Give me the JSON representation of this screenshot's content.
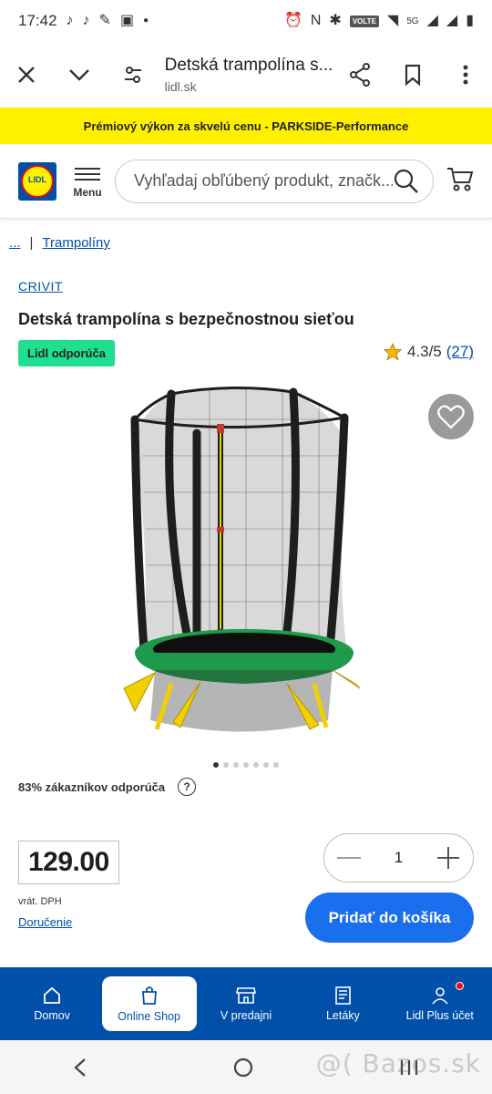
{
  "status_bar": {
    "time": "17:42",
    "network": "5G",
    "volte": "VOLTE"
  },
  "browser": {
    "title": "Detská trampolína s...",
    "url": "lidl.sk"
  },
  "promo_banner": {
    "text": "Prémiový výkon za skvelú cenu - PARKSIDE-Performance"
  },
  "header": {
    "logo_text": "LIDL",
    "menu_label": "Menu",
    "search_placeholder": "Vyhľadaj obľúbený produkt, značk..."
  },
  "breadcrumb": {
    "ellipsis": "...",
    "separator": "|",
    "category": "Trampolíny"
  },
  "product": {
    "brand": "CRIVIT",
    "title": "Detská trampolína s bezpečnostnou sieťou",
    "badge": "Lidl odporúča",
    "rating": "4.3/5",
    "rating_count": "(27)",
    "recommend": "83% zákazníkov odporúča",
    "recommend_help": "?",
    "price": "129.00",
    "vat_note": "vrát. DPH",
    "delivery_link": "Doručenie",
    "quantity": "1",
    "add_to_cart": "Pridať do košíka",
    "gallery_total": 7,
    "gallery_active": 0
  },
  "bottom_nav": [
    {
      "label": "Domov",
      "icon": "home-icon"
    },
    {
      "label": "Online Shop",
      "icon": "shopping-bag-icon",
      "active": true
    },
    {
      "label": "V predajni",
      "icon": "store-icon"
    },
    {
      "label": "Letáky",
      "icon": "leaflet-icon"
    },
    {
      "label": "Lidl Plus účet",
      "icon": "account-icon",
      "notification": true
    }
  ],
  "watermark": "@( Bazos.sk",
  "colors": {
    "lidl_blue": "#0050aa",
    "lidl_yellow": "#fff000",
    "badge_green": "#1ee08f",
    "cta_blue": "#1a6fee"
  }
}
